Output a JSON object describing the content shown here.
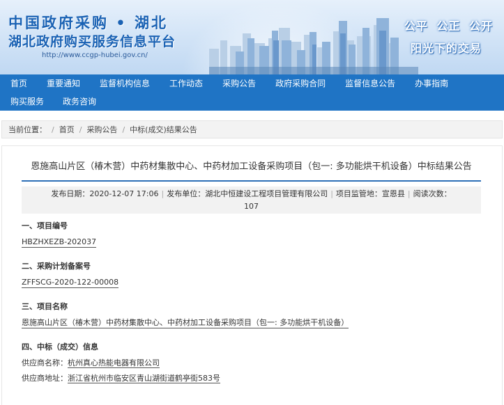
{
  "header": {
    "title_line1": "中国政府采购 • 湖北",
    "title_line2": "湖北政府购买服务信息平台",
    "url": "http://www.ccgp-hubei.gov.cn/",
    "slogan_line1": "公平  公正  公开",
    "slogan_line2": "阳光下的交易"
  },
  "nav": {
    "row1": [
      "首页",
      "重要通知",
      "监督机构信息",
      "工作动态",
      "采购公告",
      "政府采购合同",
      "监督信息公告",
      "办事指南"
    ],
    "row2": [
      "购买服务",
      "政务咨询"
    ]
  },
  "breadcrumb": {
    "label": "当前位置：",
    "items": [
      "首页",
      "采购公告",
      "中标(成交)结果公告"
    ],
    "separator": "/"
  },
  "article": {
    "title": "恩施高山片区（椿木营）中药材集散中心、中药材加工设备采购项目（包一: 多功能烘干机设备）中标结果公告",
    "meta": {
      "publish_date": "发布日期：2020-12-07 17:06",
      "publisher": "发布单位：湖北中恒建设工程项目管理有限公司",
      "supervisor": "项目监管地：宣恩县",
      "views_label": "阅读次数：",
      "views": "107"
    },
    "sections": [
      {
        "heading": "一、项目编号",
        "value": "HBZHXEZB-202037"
      },
      {
        "heading": "二、采购计划备案号",
        "value": "ZFFSCG-2020-122-00008"
      },
      {
        "heading": "三、项目名称",
        "value": "恩施高山片区（椿木营）中药材集散中心、中药材加工设备采购项目（包一: 多功能烘干机设备）"
      }
    ],
    "winner": {
      "heading": "四、中标（成交）信息",
      "supplier_label": "供应商名称：",
      "supplier_name": "杭州真心热能电器有限公司",
      "address_label": "供应商地址：",
      "address": "浙江省杭州市临安区青山湖街道鹤亭街583号"
    }
  },
  "colors": {
    "nav_bg": "#1f74c5",
    "brand_blue": "#1a62b4",
    "title_rule": "#2c6fb7"
  }
}
